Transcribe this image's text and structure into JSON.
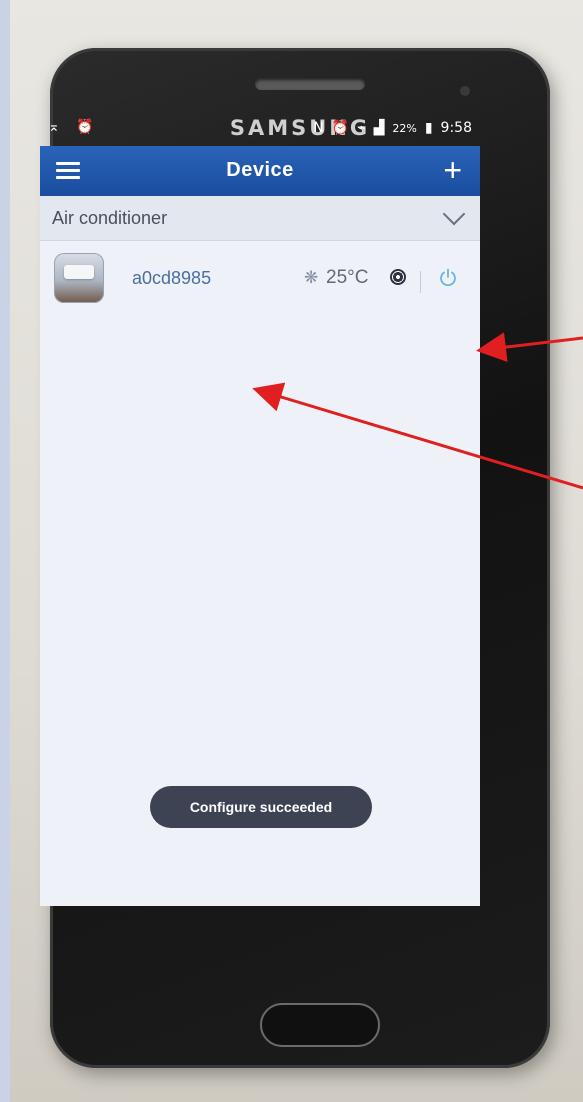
{
  "device_brand": "SAMSUNG",
  "status_bar": {
    "left_icons": [
      "notification-icon",
      "alarm-icon"
    ],
    "right_icons": [
      "nfc-icon",
      "alarm-icon",
      "vibrate-icon",
      "signal-icon"
    ],
    "battery_percent": "22%",
    "time": "9:58"
  },
  "app_bar": {
    "title": "Device",
    "menu_icon": "hamburger-menu-icon",
    "add_icon": "plus-icon"
  },
  "category": {
    "label": "Air conditioner",
    "expand_icon": "chevron-down-icon"
  },
  "devices": [
    {
      "name": "a0cd8985",
      "fan_icon": "fan-icon",
      "temperature": "25°C",
      "mode_icon": "mode-icon",
      "power_icon": "power-icon",
      "power_color": "#6fb4e0"
    }
  ],
  "toast": "Configure succeeded",
  "colors": {
    "app_bar": "#1a4d9e",
    "annotation_arrow": "#e02020"
  }
}
